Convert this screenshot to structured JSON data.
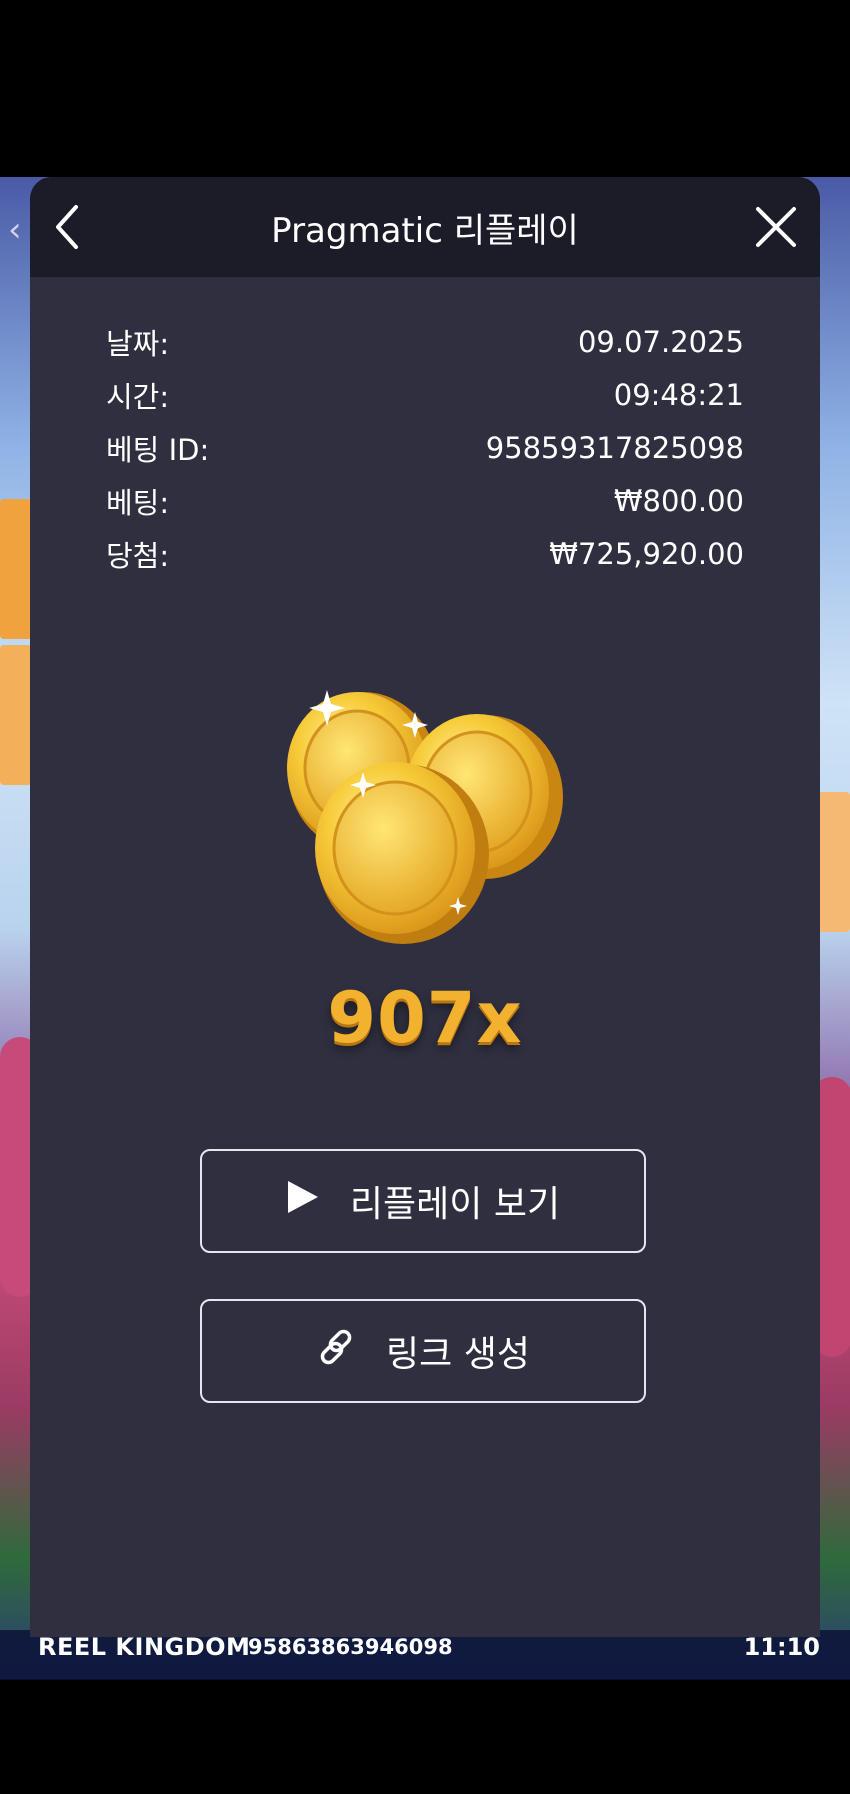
{
  "background": {
    "provider": "REEL KINGDOM",
    "round_id": "95863863946098",
    "clock": "11:10",
    "back_glyph": "‹"
  },
  "modal": {
    "title": "Pragmatic 리플레이",
    "back_icon": "chevron-left-icon",
    "close_icon": "close-icon",
    "details": [
      {
        "label": "날짜:",
        "value": "09.07.2025"
      },
      {
        "label": "시간:",
        "value": "09:48:21"
      },
      {
        "label": "베팅 ID:",
        "value": "95859317825098"
      },
      {
        "label": "베팅:",
        "value": "₩800.00"
      },
      {
        "label": "당첨:",
        "value": "₩725,920.00"
      }
    ],
    "multiplier": "907x",
    "buttons": {
      "replay_label": "리플레이 보기",
      "replay_icon": "play-icon",
      "link_label": "링크 생성",
      "link_icon": "link-icon"
    }
  },
  "colors": {
    "modal_bg": "#2f2f3f",
    "header_bg": "#1c1c28",
    "multiplier": "#f2b12e",
    "coin_gold": "#f5c53a"
  }
}
